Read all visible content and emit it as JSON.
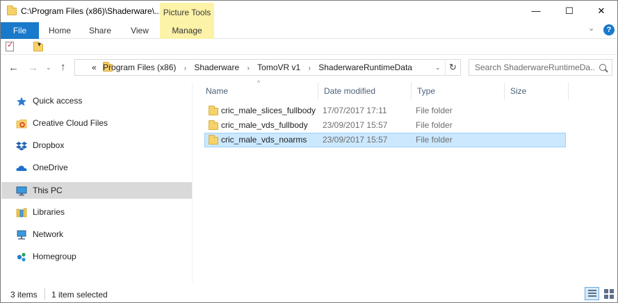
{
  "window": {
    "title": "C:\\Program Files (x86)\\Shaderware\\...",
    "context_tab": "Picture Tools",
    "minimize_glyph": "—",
    "maximize_glyph": "☐",
    "close_glyph": "✕"
  },
  "ribbon": {
    "tabs": [
      "File",
      "Home",
      "Share",
      "View",
      "Manage"
    ],
    "collapse_glyph": "⌄",
    "help_glyph": "?",
    "file_color": "#1979ca"
  },
  "qat": {
    "dropdown_glyph": "▾"
  },
  "nav": {
    "back_glyph": "←",
    "forward_glyph": "→",
    "recent_glyph": "⌄",
    "up_glyph": "↑",
    "overflow": "«",
    "breadcrumbs": [
      "Program Files (x86)",
      "Shaderware",
      "TomoVR v1",
      "ShaderwareRuntimeData"
    ],
    "separator": "›",
    "dropdown_glyph": "⌄",
    "refresh_glyph": "↻",
    "search_placeholder": "Search ShaderwareRuntimeDa..."
  },
  "navpane": {
    "items": [
      {
        "label": "Quick access",
        "icon": "star-icon"
      },
      {
        "label": "Creative Cloud Files",
        "icon": "creative-cloud-icon"
      },
      {
        "label": "Dropbox",
        "icon": "dropbox-icon"
      },
      {
        "label": "OneDrive",
        "icon": "onedrive-icon"
      },
      {
        "label": "This PC",
        "icon": "computer-icon",
        "selected": true
      },
      {
        "label": "Libraries",
        "icon": "libraries-icon"
      },
      {
        "label": "Network",
        "icon": "network-icon"
      },
      {
        "label": "Homegroup",
        "icon": "homegroup-icon"
      }
    ]
  },
  "columns": {
    "name": "Name",
    "date": "Date modified",
    "type": "Type",
    "size": "Size",
    "sort_glyph": "^"
  },
  "files": [
    {
      "name": "cric_male_slices_fullbody",
      "date": "17/07/2017 17:11",
      "type": "File folder",
      "selected": false
    },
    {
      "name": "cric_male_vds_fullbody",
      "date": "23/09/2017 15:57",
      "type": "File folder",
      "selected": false
    },
    {
      "name": "cric_male_vds_noarms",
      "date": "23/09/2017 15:57",
      "type": "File folder",
      "selected": true
    }
  ],
  "status": {
    "items": "3 items",
    "selected": "1 item selected"
  },
  "colors": {
    "selection_bg": "#cce8ff",
    "selection_border": "#99d1ff",
    "picture_tools_bg": "#fcf2a8",
    "nav_selected_bg": "#d9d9d9"
  }
}
